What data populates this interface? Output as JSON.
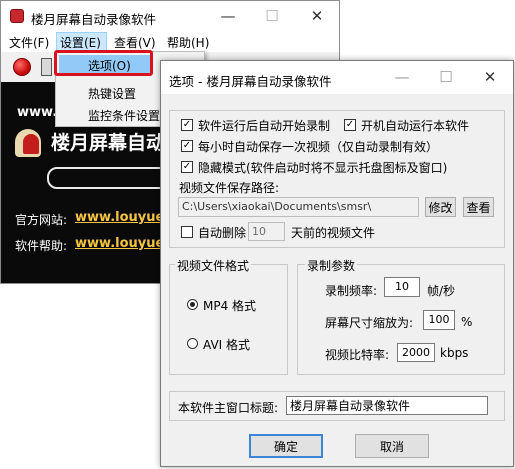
{
  "main_window": {
    "title": "楼月屏幕自动录像软件",
    "controls": {
      "minimize": "—",
      "maximize": "☐",
      "close": "✕"
    },
    "menus": [
      "文件(F)",
      "设置(E)",
      "查看(V)",
      "帮助(H)"
    ],
    "banner": {
      "site_partial": "www.lo",
      "logo_text": "楼月屏幕自动",
      "official_site_label": "官方网站:",
      "official_site_url": "www.louyue.com",
      "help_label": "软件帮助:",
      "help_url": "www.louyue.com"
    }
  },
  "settings_menu": {
    "items": [
      "选项(O)",
      "热键设置",
      "监控条件设置"
    ],
    "highlighted_index": 0
  },
  "options_dialog": {
    "title": "选项 - 楼月屏幕自动录像软件",
    "controls": {
      "minimize": "—",
      "maximize": "☐",
      "close": "✕"
    },
    "auto_record_on_start": {
      "label": "软件运行后自动开始录制",
      "checked": true
    },
    "run_on_boot": {
      "label": "开机自动运行本软件",
      "checked": true
    },
    "hourly_save": {
      "label": "每小时自动保存一次视频（仅自动录制有效）",
      "checked": true
    },
    "hidden_mode": {
      "label": "隐藏模式(软件启动时将不显示托盘图标及窗口)",
      "checked": true
    },
    "save_path_label": "视频文件保存路径:",
    "save_path_value": "C:\\Users\\xiaokai\\Documents\\smsr\\",
    "modify_button": "修改",
    "view_button": "查看",
    "auto_delete": {
      "prefix": "自动删除",
      "days": "10",
      "suffix": "天前的视频文件",
      "checked": false
    },
    "format_group": {
      "title": "视频文件格式",
      "options": [
        "MP4 格式",
        "AVI 格式"
      ],
      "selected_index": 0
    },
    "params_group": {
      "title": "录制参数",
      "fps_label": "录制频率:",
      "fps_value": "10",
      "fps_unit": "帧/秒",
      "scale_label": "屏幕尺寸缩放为:",
      "scale_value": "100",
      "scale_unit": "%",
      "bitrate_label": "视频比特率:",
      "bitrate_value": "2000",
      "bitrate_unit": "kbps"
    },
    "window_title_label": "本软件主窗口标题:",
    "window_title_value": "楼月屏幕自动录像软件",
    "ok_button": "确定",
    "cancel_button": "取消"
  },
  "colors": {
    "highlight_frame": "#d8121e",
    "menu_selection": "#91c9f7",
    "link": "#f5c542",
    "banner_background": "#0a0a0a"
  }
}
